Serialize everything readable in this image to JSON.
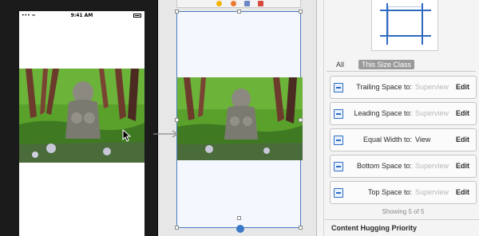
{
  "status_bar": {
    "carrier": "•••  ≈",
    "time": "9:41 AM"
  },
  "inspector": {
    "filter_all": "All",
    "filter_size_class": "This Size Class",
    "constraints": [
      {
        "label": "Trailing Space to:",
        "target": "Superview",
        "target_style": "placeholder",
        "action": "Edit",
        "icon": "trailing-space-icon"
      },
      {
        "label": "Leading Space to:",
        "target": "Superview",
        "target_style": "placeholder",
        "action": "Edit",
        "icon": "leading-space-icon"
      },
      {
        "label": "Equal Width to:",
        "target": "View",
        "target_style": "value",
        "action": "Edit",
        "icon": "equal-width-icon"
      },
      {
        "label": "Bottom Space to:",
        "target": "Superview",
        "target_style": "placeholder",
        "action": "Edit",
        "icon": "bottom-space-icon"
      },
      {
        "label": "Top Space to:",
        "target": "Superview",
        "target_style": "placeholder",
        "action": "Edit",
        "icon": "top-space-icon"
      }
    ],
    "showing": "Showing 5 of 5",
    "section_title": "Content Hugging Priority"
  },
  "colors": {
    "accent": "#2f6ac0",
    "selection": "#4a7dbd",
    "grass": "#5aa12c"
  }
}
